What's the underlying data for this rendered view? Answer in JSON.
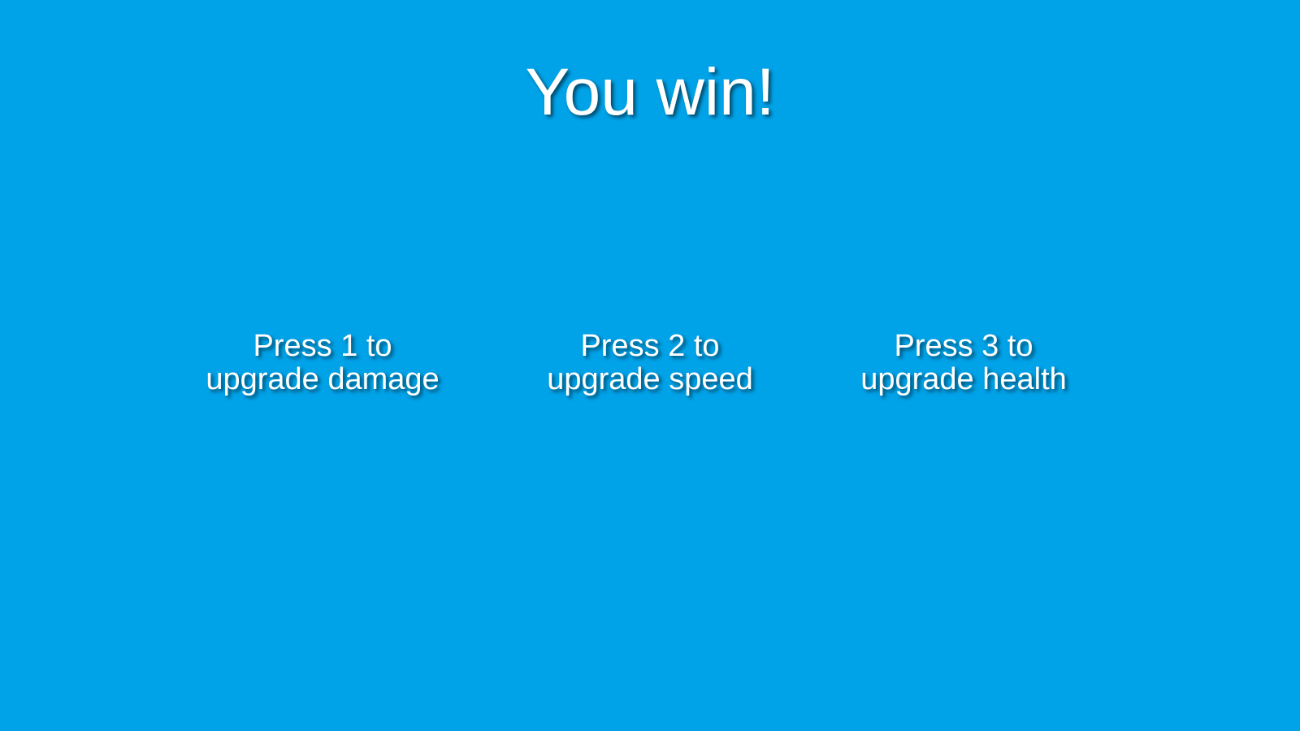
{
  "screen": {
    "background_color": "#00A2E8",
    "title": "You win!"
  },
  "options": [
    {
      "line1": "Press 1 to",
      "line2": "upgrade damage"
    },
    {
      "line1": "Press 2 to",
      "line2": "upgrade speed"
    },
    {
      "line1": "Press 3 to",
      "line2": "upgrade health"
    }
  ]
}
